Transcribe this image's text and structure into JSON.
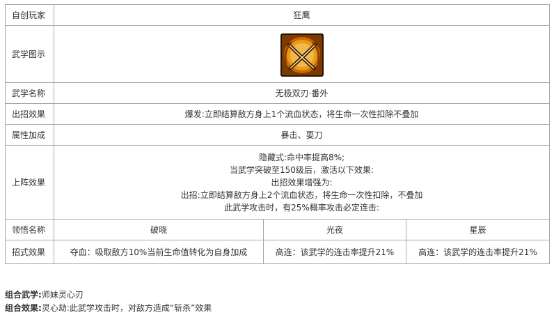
{
  "table": {
    "rows": {
      "player": {
        "label": "自创玩家",
        "value": "狂鹰"
      },
      "icon": {
        "label": "武学图示",
        "icon_name": "crossed-blades-icon"
      },
      "name": {
        "label": "武学名称",
        "value": "无极双刃·番外"
      },
      "effect": {
        "label": "出招效果",
        "value": "爆发:立即结算敌方身上1个流血状态，将生命一次性扣除不叠加"
      },
      "attr": {
        "label": "属性加成",
        "value": "暴击、耍刀"
      },
      "formation": {
        "label": "上阵效果",
        "lines": [
          "隐藏式:命中率提高8%;",
          "当武学突破至150级后，激活以下效果:",
          "出招效果增强为:",
          "出招:立即结算敌方身上2个流血状态，将生命一次性扣除，不叠加",
          "此武学攻击时，有25%概率攻击必定连击:"
        ]
      },
      "insight": {
        "label": "领悟名称",
        "names": [
          "破晓",
          "光夜",
          "星辰"
        ]
      },
      "moves": {
        "label": "招式效果",
        "values": [
          "夺血：吸取敌方10%当前生命值转化为自身加成",
          "高连：该武学的连击率提升21%",
          "高连：该武学的连击率提升21%"
        ]
      }
    }
  },
  "footer": {
    "combo_label": "组合武学:",
    "combo_value": "师妹灵心刃",
    "effect_label": "组合效果:",
    "effect_value": "灵心劫:此武学攻击时，对敌方造成“斩杀”效果"
  },
  "colors": {
    "border": "#a8a8a8",
    "text": "#333333",
    "icon_gold": "#e8a020",
    "icon_dark": "#3a1a00"
  }
}
